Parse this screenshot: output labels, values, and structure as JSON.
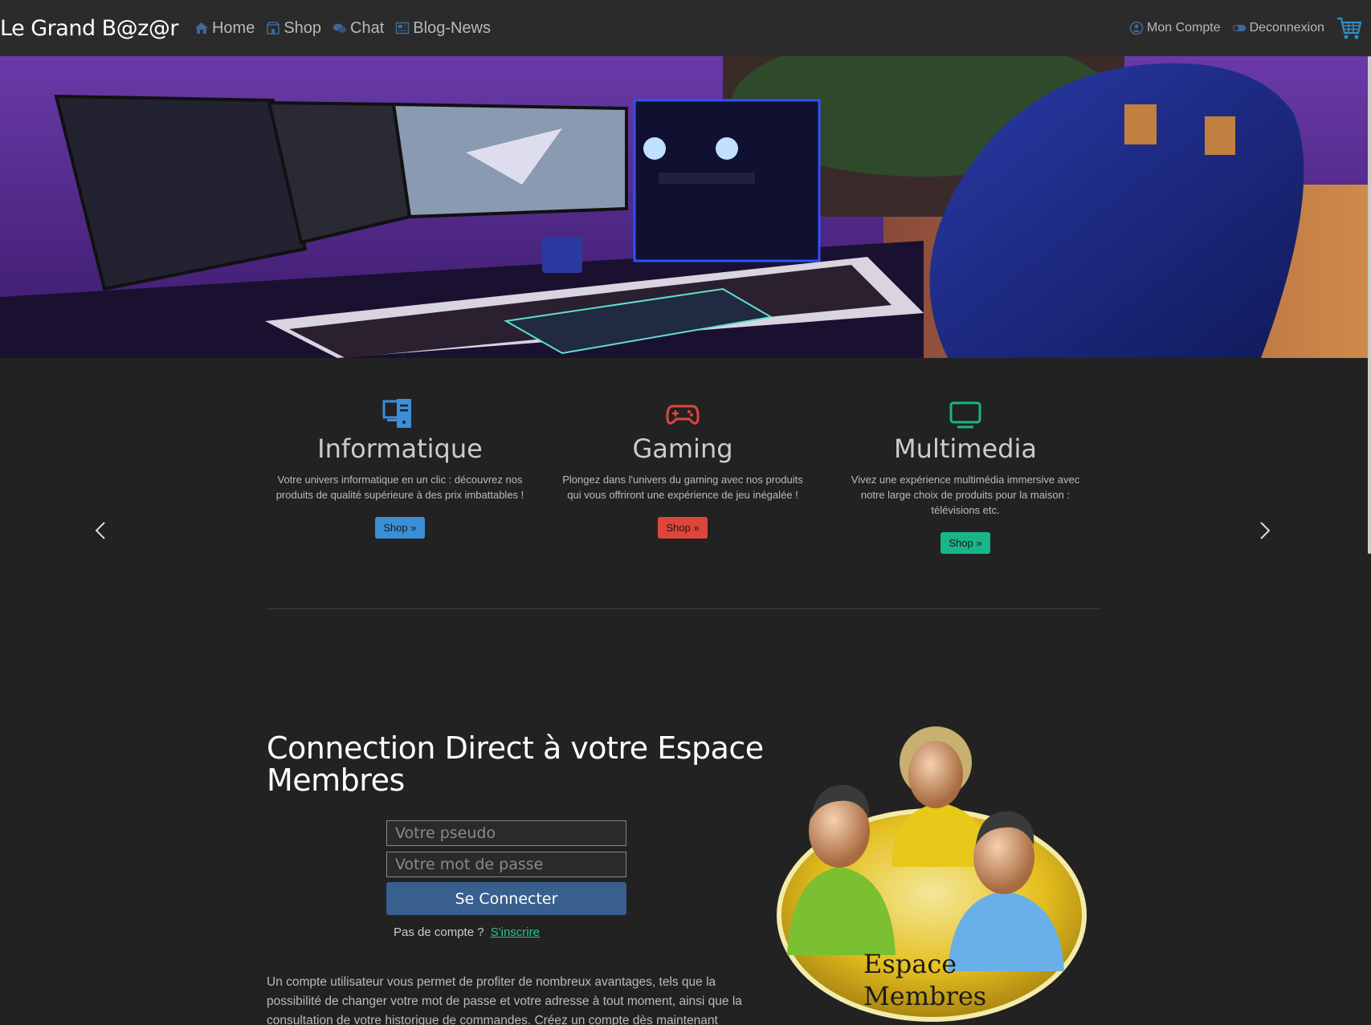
{
  "brand": "Le Grand B@z@r",
  "nav": {
    "home": "Home",
    "shop": "Shop",
    "chat": "Chat",
    "blog": "Blog-News",
    "account": "Mon Compte",
    "logout": "Deconnexion"
  },
  "icons": {
    "home": "home-icon",
    "shop": "shop-icon",
    "chat": "chat-icon",
    "blog": "blog-icon",
    "account": "user-circle-icon",
    "logout": "toggle-icon",
    "cart": "cart-icon"
  },
  "features": [
    {
      "title": "Informatique",
      "text": "Votre univers informatique en un clic : découvrez nos produits de qualité supérieure à des prix imbattables !",
      "button": "Shop »",
      "color": "#3b8fd6"
    },
    {
      "title": "Gaming",
      "text": "Plongez dans l'univers du gaming avec nos produits qui vous offriront une expérience de jeu inégalée !",
      "button": "Shop »",
      "color": "#e0453b"
    },
    {
      "title": "Multimedia",
      "text": "Vivez une expérience multimédia immersive avec notre large choix de produits pour la maison : télévisions etc.",
      "button": "Shop »",
      "color": "#17b587"
    }
  ],
  "login": {
    "title": "Connection Direct à votre Espace Membres",
    "username_placeholder": "Votre pseudo",
    "password_placeholder": "Votre mot de passe",
    "submit": "Se Connecter",
    "no_account": "Pas de compte ?",
    "signup_link": "S'inscrire",
    "description": "Un compte utilisateur vous permet de profiter de nombreux avantages, tels que la possibilité de changer votre mot de passe et votre adresse à tout moment, ainsi que la consultation de votre historique de commandes. Créez un compte dès maintenant"
  },
  "members_badge": {
    "line1": "Espace",
    "line2": "Membres"
  }
}
